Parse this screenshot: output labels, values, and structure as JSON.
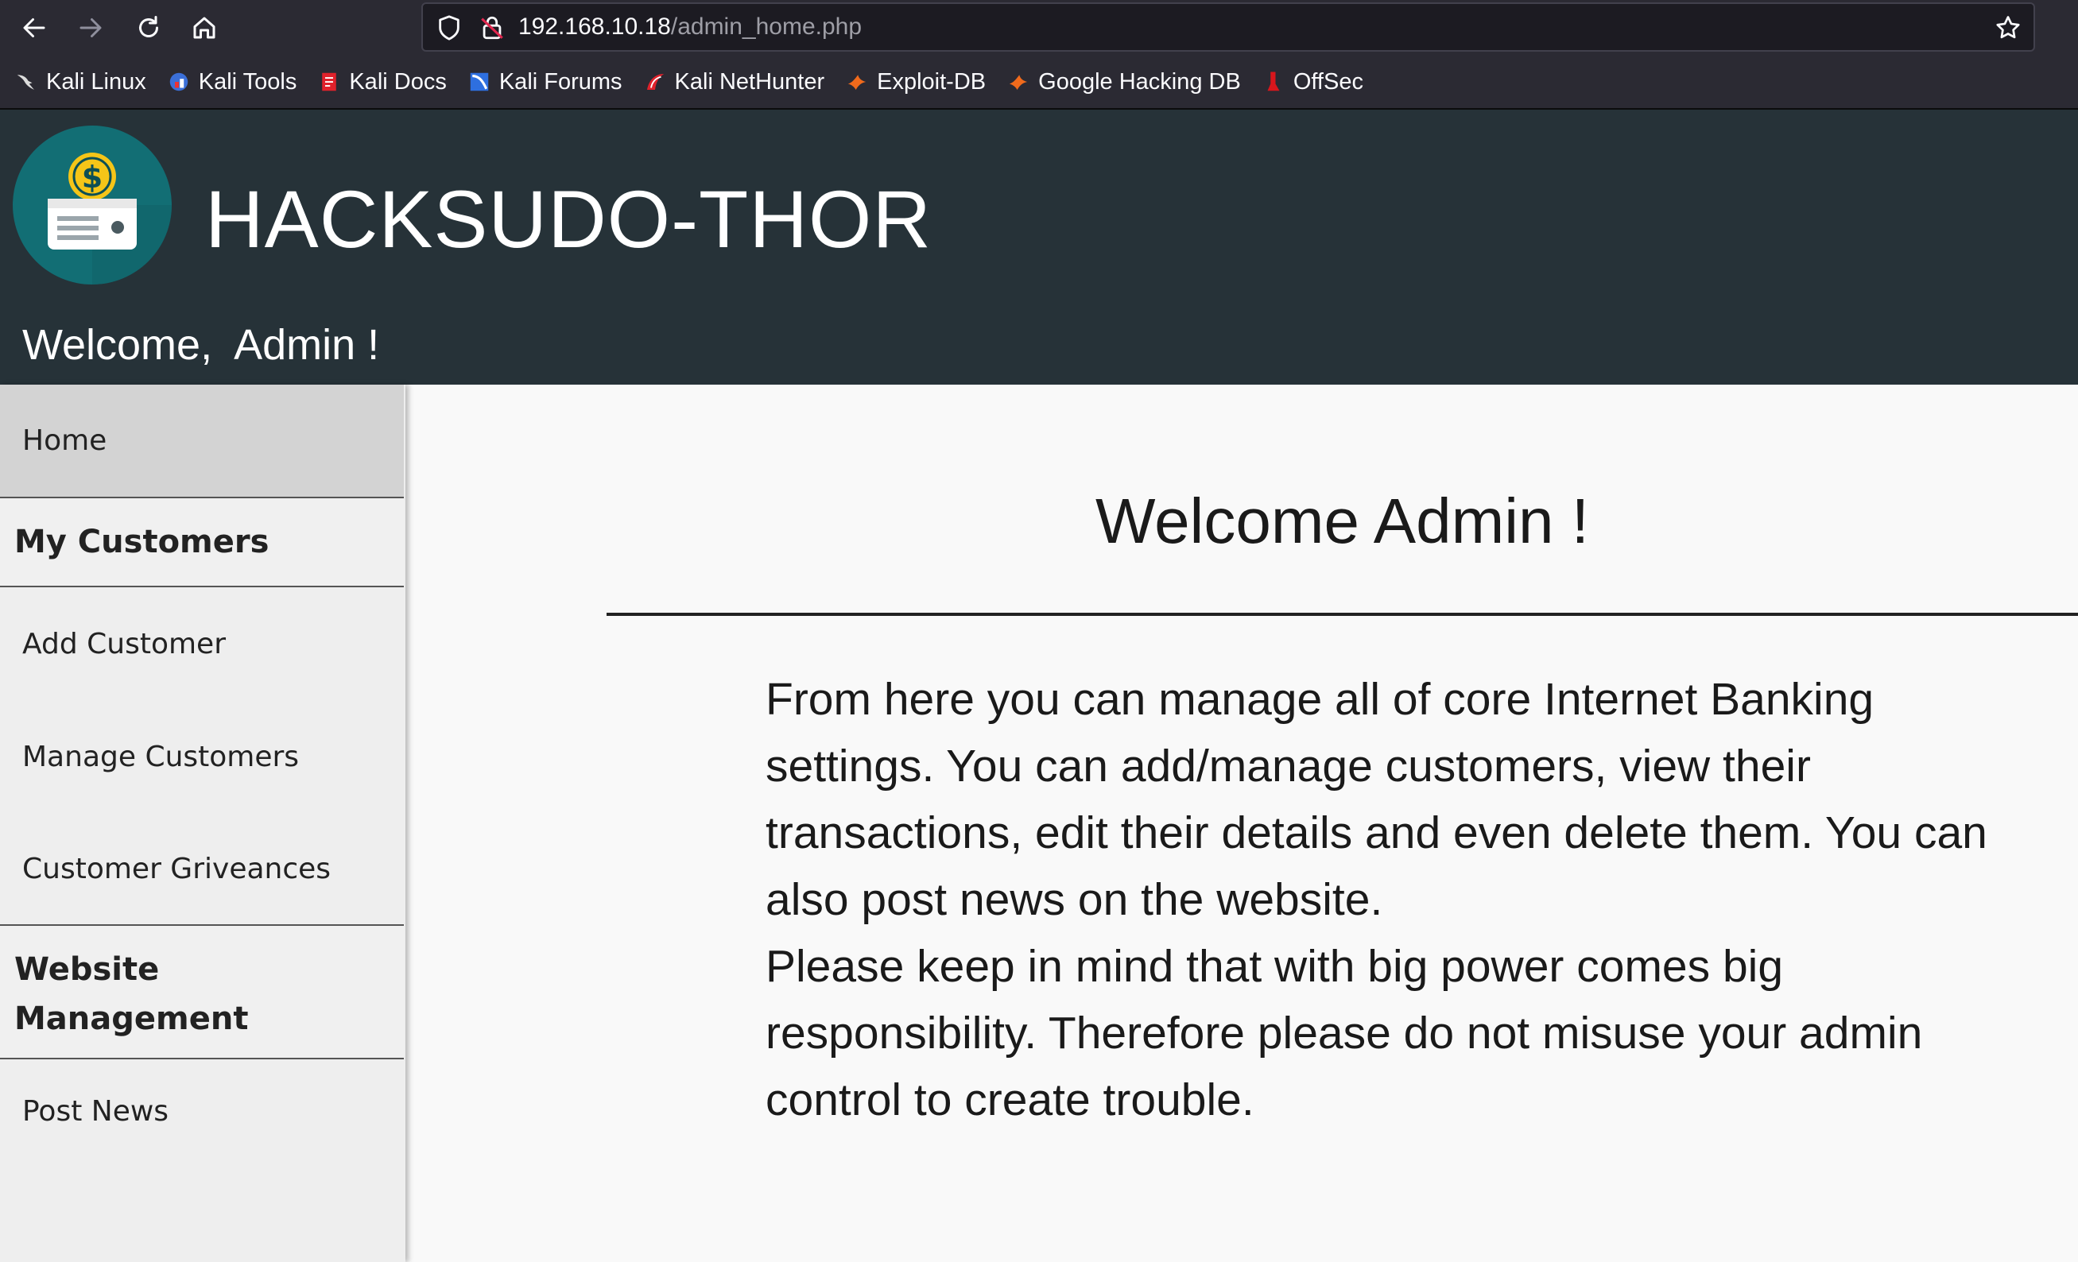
{
  "browser": {
    "url_host": "192.168.10.18",
    "url_path": "/admin_home.php",
    "bookmarks": [
      {
        "label": "Kali Linux",
        "icon": "kali-dragon-icon"
      },
      {
        "label": "Kali Tools",
        "icon": "kali-tools-icon"
      },
      {
        "label": "Kali Docs",
        "icon": "kali-docs-icon"
      },
      {
        "label": "Kali Forums",
        "icon": "kali-forums-icon"
      },
      {
        "label": "Kali NetHunter",
        "icon": "kali-nethunter-icon"
      },
      {
        "label": "Exploit-DB",
        "icon": "exploit-db-icon"
      },
      {
        "label": "Google Hacking DB",
        "icon": "ghdb-icon"
      },
      {
        "label": "OffSec",
        "icon": "offsec-icon"
      }
    ]
  },
  "header": {
    "site_title": "HACKSUDO-THOR",
    "welcome_user": "Welcome,  Admin !",
    "logo_icon": "bank-cash-logo-icon"
  },
  "sidebar": {
    "home": "Home",
    "customers_heading": "My Customers",
    "add_customer": "Add Customer",
    "manage_customers": "Manage Customers",
    "customer_grievances": "Customer Griveances",
    "website_heading_line1": "Website",
    "website_heading_line2": "Management",
    "post_news": "Post News"
  },
  "main": {
    "title": "Welcome Admin !",
    "paragraph1": "From here you can manage all of core Internet Banking settings. You can add/manage customers, view their transactions, edit their details and even delete them. You can also post news on the website.",
    "paragraph2": "Please keep in mind that with big power comes big responsibility. Therefore please do not misuse your admin control to create trouble."
  },
  "colors": {
    "header_bg": "#263238",
    "logo_circle": "#126e74",
    "sidebar_bg": "#eeeeee",
    "sidebar_active": "#d3d3d3",
    "browser_chrome": "#2b2a33"
  }
}
